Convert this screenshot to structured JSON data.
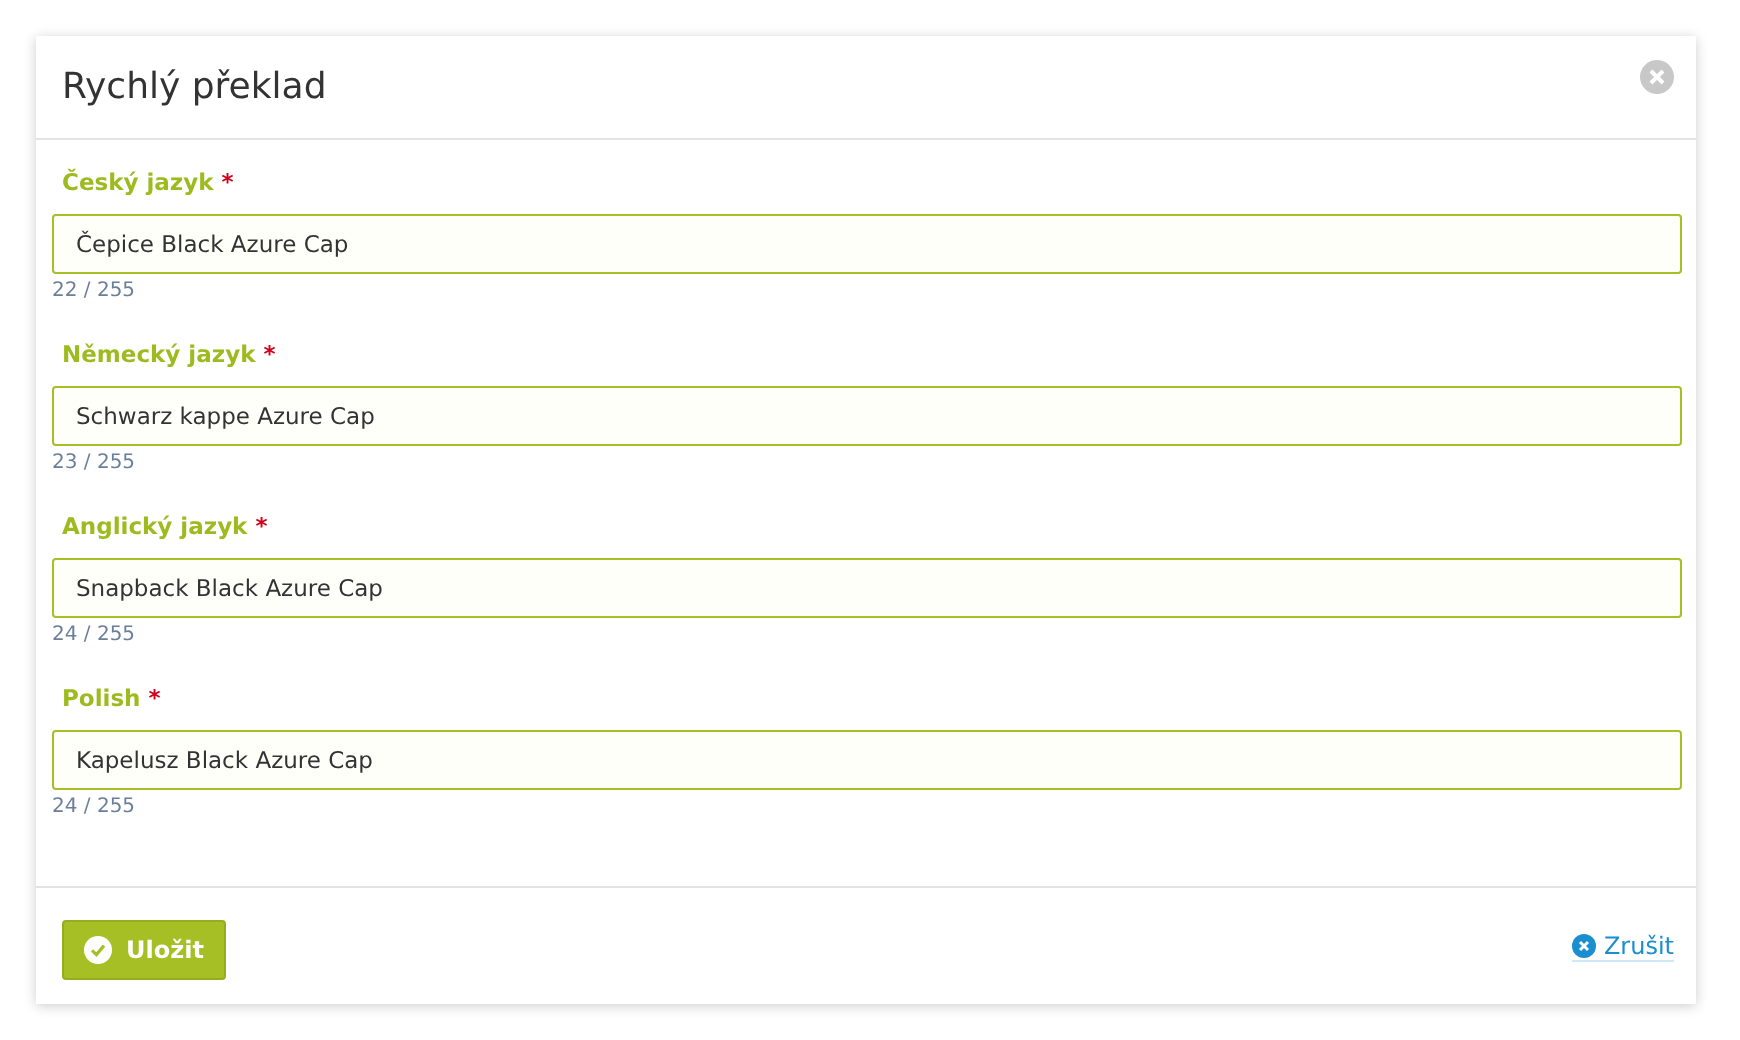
{
  "dialog": {
    "title": "Rychlý překlad"
  },
  "fields": [
    {
      "label": "Český jazyk",
      "required": true,
      "value": "Čepice Black Azure Cap",
      "counter": "22 / 255"
    },
    {
      "label": "Německý jazyk",
      "required": true,
      "value": "Schwarz kappe Azure Cap",
      "counter": "23 / 255"
    },
    {
      "label": "Anglický jazyk",
      "required": true,
      "value": "Snapback Black Azure Cap",
      "counter": "24 / 255"
    },
    {
      "label": "Polish",
      "required": true,
      "value": "Kapelusz Black Azure Cap",
      "counter": "24 / 255"
    }
  ],
  "required_mark": "*",
  "save_button": "Uložit",
  "cancel_link": "Zrušit"
}
